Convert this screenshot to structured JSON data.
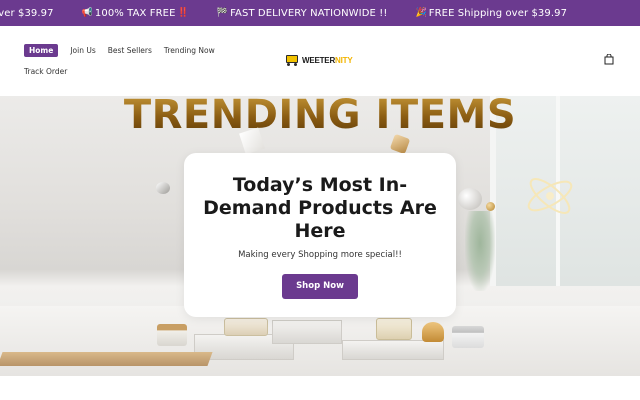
{
  "announcement": {
    "items": [
      {
        "icon": "",
        "text": "over $39.97"
      },
      {
        "icon": "megaphone-icon",
        "glyph": "📢",
        "text": "100% TAX FREE",
        "suffix": "‼️"
      },
      {
        "icon": "checkered-flag-icon",
        "glyph": "🏁",
        "text": "FAST DELIVERY NATIONWIDE !!",
        "suffix": ""
      },
      {
        "icon": "party-popper-icon",
        "glyph": "🎉",
        "text": "FREE Shipping over $39.97",
        "suffix": ""
      }
    ],
    "background": "#6b3a8f"
  },
  "header": {
    "nav": {
      "home": "Home",
      "join_us": "Join Us",
      "best_sellers": "Best Sellers",
      "trending_now": "Trending Now",
      "track_order": "Track Order"
    },
    "logo": {
      "part1": "WEETER",
      "part2": "NITY",
      "icon": "shopping-cart-icon"
    },
    "cart_icon": "shopping-bag-icon"
  },
  "hero": {
    "heading": "TRENDING ITEMS",
    "card": {
      "title_line1": "Today’s Most In-",
      "title_line2": "Demand Products Are",
      "title_line3": "Here",
      "subtitle": "Making every Shopping more special!!",
      "button_label": "Shop Now"
    }
  },
  "colors": {
    "brand": "#6b3a8f",
    "gold": "#8a5c12",
    "accent_yellow": "#f2b400"
  }
}
